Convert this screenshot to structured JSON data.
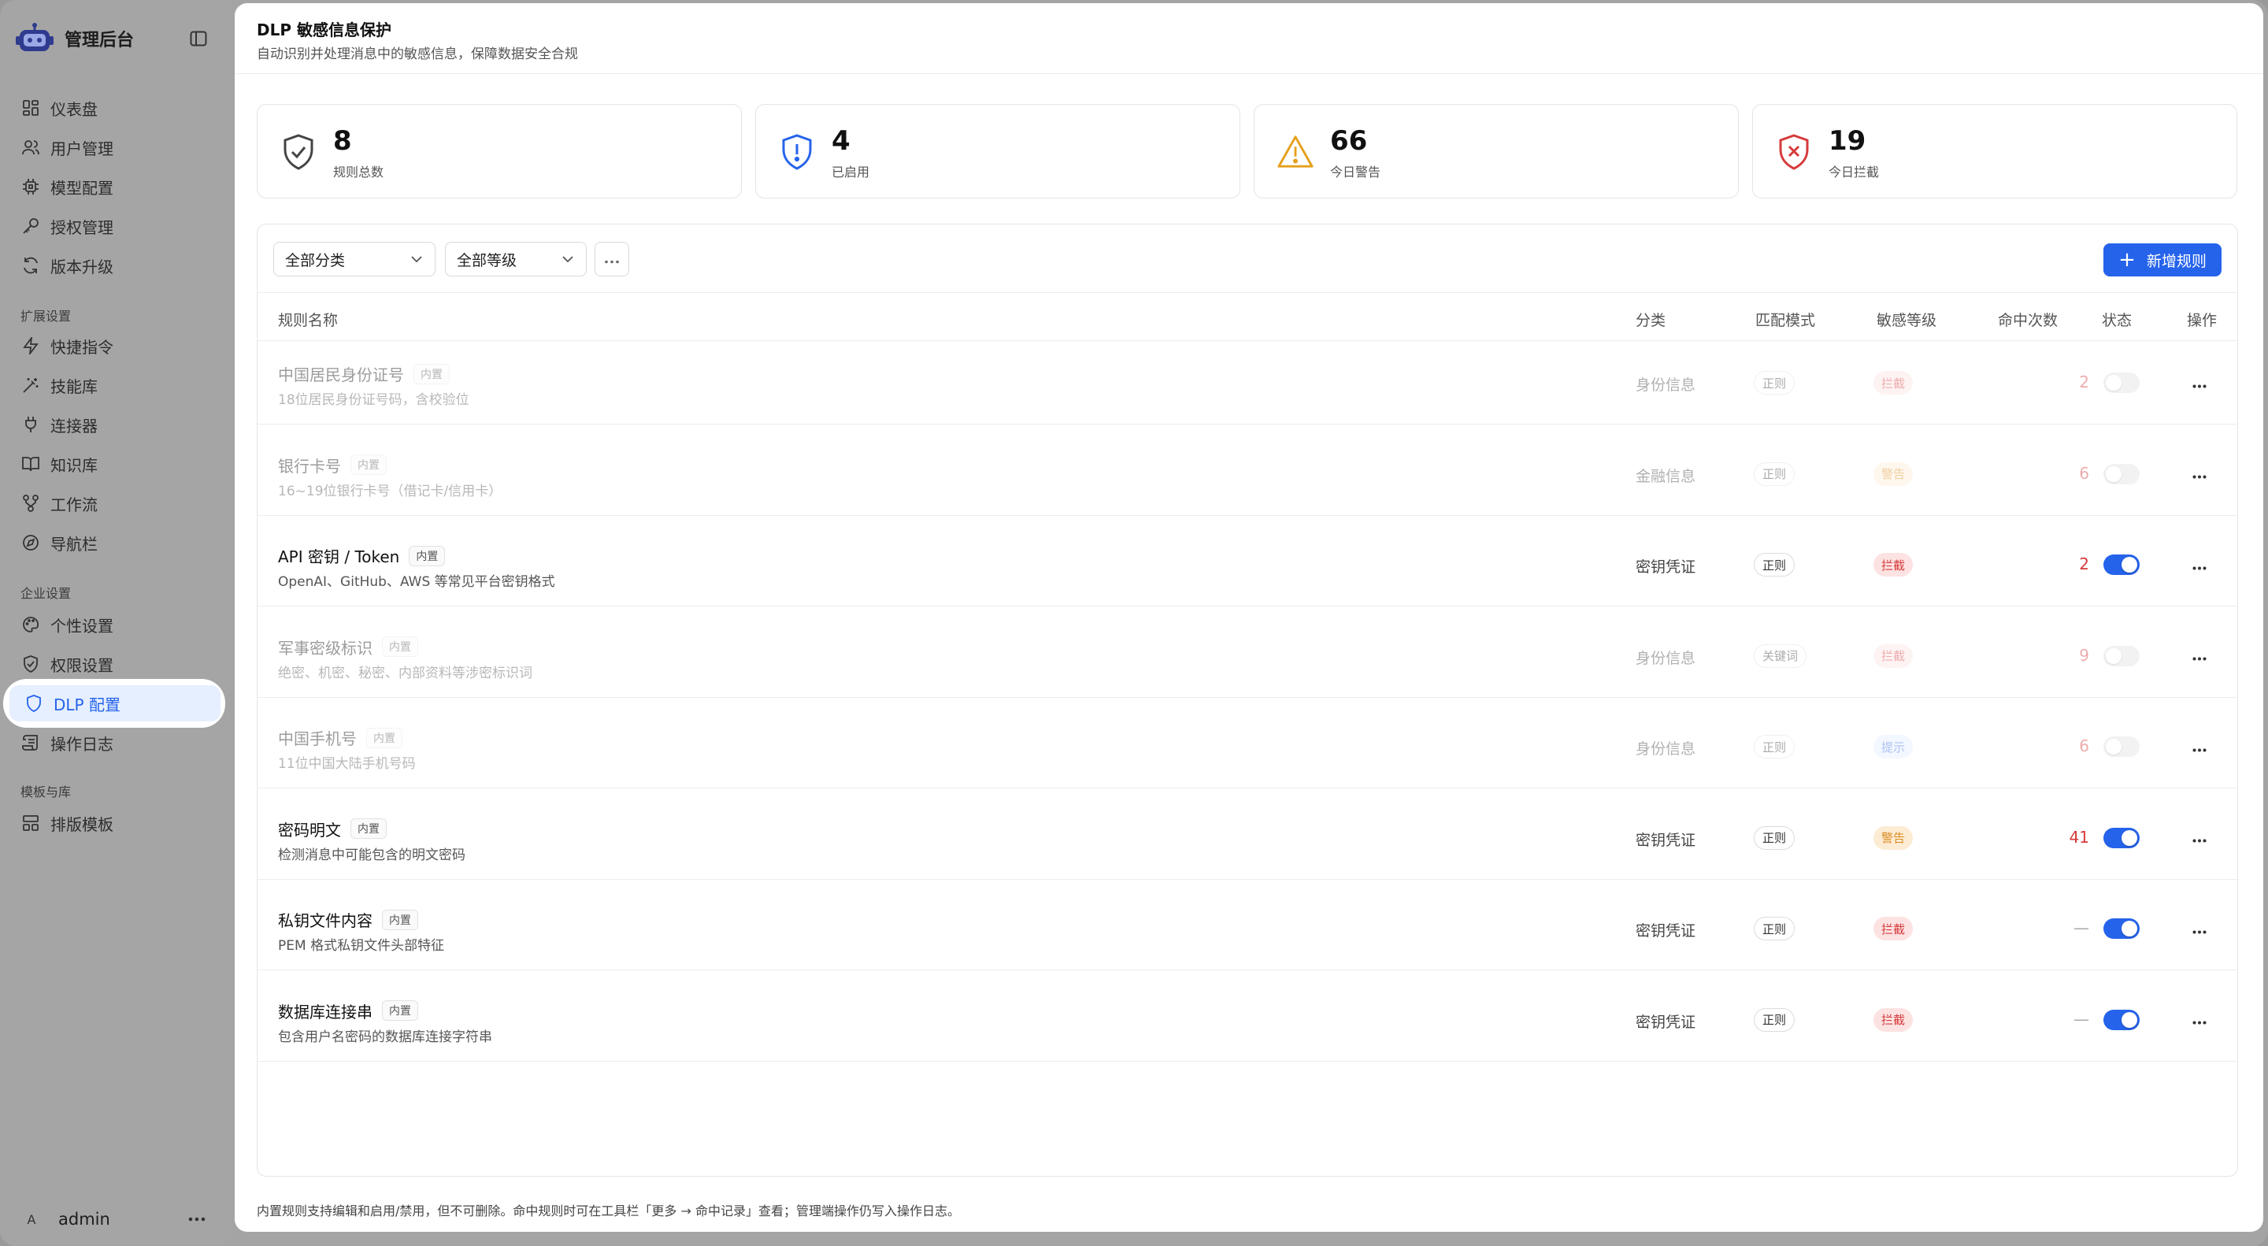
{
  "sidebar": {
    "brand": "管理后台",
    "items": [
      {
        "label": "仪表盘"
      },
      {
        "label": "用户管理"
      },
      {
        "label": "模型配置"
      },
      {
        "label": "授权管理"
      },
      {
        "label": "版本升级"
      },
      {
        "label": "快捷指令"
      },
      {
        "label": "技能库"
      },
      {
        "label": "连接器"
      },
      {
        "label": "知识库"
      },
      {
        "label": "工作流"
      },
      {
        "label": "导航栏"
      },
      {
        "label": "个性设置"
      },
      {
        "label": "权限设置"
      },
      {
        "label": "DLP 配置"
      },
      {
        "label": "操作日志"
      },
      {
        "label": "排版模板"
      }
    ],
    "sections": {
      "extensions": "扩展设置",
      "enterprise": "企业设置",
      "templates": "模板与库"
    },
    "user": {
      "initial": "A",
      "name": "admin"
    }
  },
  "header": {
    "title": "DLP 敏感信息保护",
    "subtitle": "自动识别并处理消息中的敏感信息，保障数据安全合规"
  },
  "stats": [
    {
      "value": "8",
      "label": "规则总数"
    },
    {
      "value": "4",
      "label": "已启用"
    },
    {
      "value": "66",
      "label": "今日警告"
    },
    {
      "value": "19",
      "label": "今日拦截"
    }
  ],
  "toolbar": {
    "category_filter": "全部分类",
    "level_filter": "全部等级",
    "add_label": "新增规则"
  },
  "table": {
    "columns": {
      "name": "规则名称",
      "category": "分类",
      "mode": "匹配模式",
      "level": "敏感等级",
      "hits": "命中次数",
      "status": "状态",
      "action": "操作"
    },
    "rows": [
      {
        "name": "中国居民身份证号",
        "badge": "内置",
        "desc": "18位居民身份证号码，含校验位",
        "category": "身份信息",
        "mode": "正则",
        "level": "拦截",
        "hits": "2",
        "enabled": false
      },
      {
        "name": "银行卡号",
        "badge": "内置",
        "desc": "16~19位银行卡号（借记卡/信用卡）",
        "category": "金融信息",
        "mode": "正则",
        "level": "警告",
        "hits": "6",
        "enabled": false
      },
      {
        "name": "API 密钥 / Token",
        "badge": "内置",
        "desc": "OpenAI、GitHub、AWS 等常见平台密钥格式",
        "category": "密钥凭证",
        "mode": "正则",
        "level": "拦截",
        "hits": "2",
        "enabled": true
      },
      {
        "name": "军事密级标识",
        "badge": "内置",
        "desc": "绝密、机密、秘密、内部资料等涉密标识词",
        "category": "身份信息",
        "mode": "关键词",
        "level": "拦截",
        "hits": "9",
        "enabled": false
      },
      {
        "name": "中国手机号",
        "badge": "内置",
        "desc": "11位中国大陆手机号码",
        "category": "身份信息",
        "mode": "正则",
        "level": "提示",
        "hits": "6",
        "enabled": false
      },
      {
        "name": "密码明文",
        "badge": "内置",
        "desc": "检测消息中可能包含的明文密码",
        "category": "密钥凭证",
        "mode": "正则",
        "level": "警告",
        "hits": "41",
        "enabled": true
      },
      {
        "name": "私钥文件内容",
        "badge": "内置",
        "desc": "PEM 格式私钥文件头部特征",
        "category": "密钥凭证",
        "mode": "正则",
        "level": "拦截",
        "hits": "—",
        "enabled": true
      },
      {
        "name": "数据库连接串",
        "badge": "内置",
        "desc": "包含用户名密码的数据库连接字符串",
        "category": "密钥凭证",
        "mode": "正则",
        "level": "拦截",
        "hits": "—",
        "enabled": true
      }
    ]
  },
  "footnote": "内置规则支持编辑和启用/禁用，但不可删除。命中规则时可在工具栏「更多 → 命中记录」查看；管理端操作仍写入操作日志。",
  "colors": {
    "accent": "#2563eb",
    "block": "#d63a3a",
    "warn": "#d98a1c",
    "hint": "#3d6fe0"
  }
}
